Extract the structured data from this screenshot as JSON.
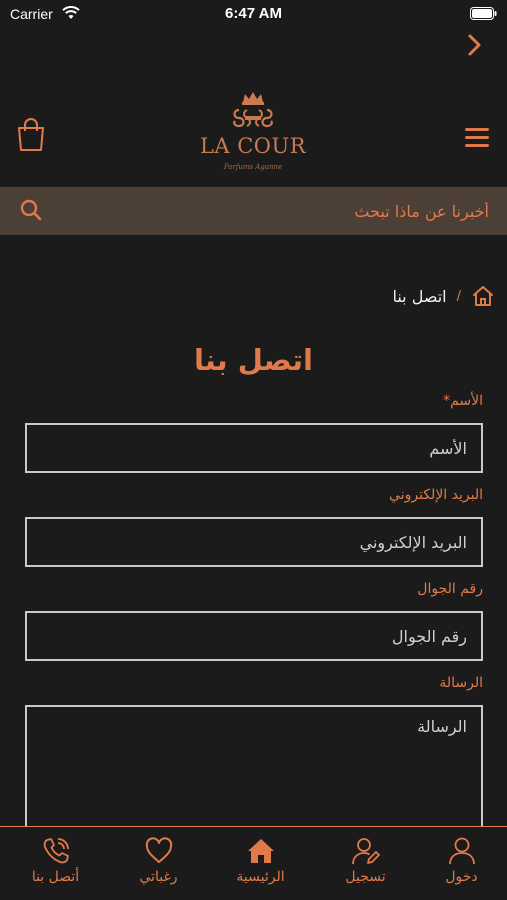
{
  "status_bar": {
    "carrier": "Carrier",
    "time": "6:47 AM"
  },
  "brand": {
    "name": "LA COUR",
    "tagline": "Parfums Aganne"
  },
  "search": {
    "placeholder": "أخبرنا عن ماذا تبحث"
  },
  "breadcrumb": {
    "separator": "/",
    "current": "اتصل بنا"
  },
  "page": {
    "title": "اتصل بنا"
  },
  "form": {
    "name": {
      "label": "الأسم*",
      "placeholder": "الأسم"
    },
    "email": {
      "label": "البريد الإلكتروني",
      "placeholder": "البريد الإلكتروني"
    },
    "phone": {
      "label": "رقم الجوال",
      "placeholder": "رقم الجوال"
    },
    "message": {
      "label": "الرسالة",
      "placeholder": "الرسالة"
    }
  },
  "bottom_nav": {
    "items": [
      {
        "label": "أتصل بنا",
        "icon": "phone-icon"
      },
      {
        "label": "رغباتي",
        "icon": "heart-icon"
      },
      {
        "label": "الرئيسية",
        "icon": "home-icon"
      },
      {
        "label": "تسجيل",
        "icon": "user-edit-icon"
      },
      {
        "label": "دخول",
        "icon": "user-icon"
      }
    ]
  },
  "colors": {
    "accent": "#e07a4a",
    "background": "#1c1b1b",
    "search_bar": "#4c4036"
  }
}
